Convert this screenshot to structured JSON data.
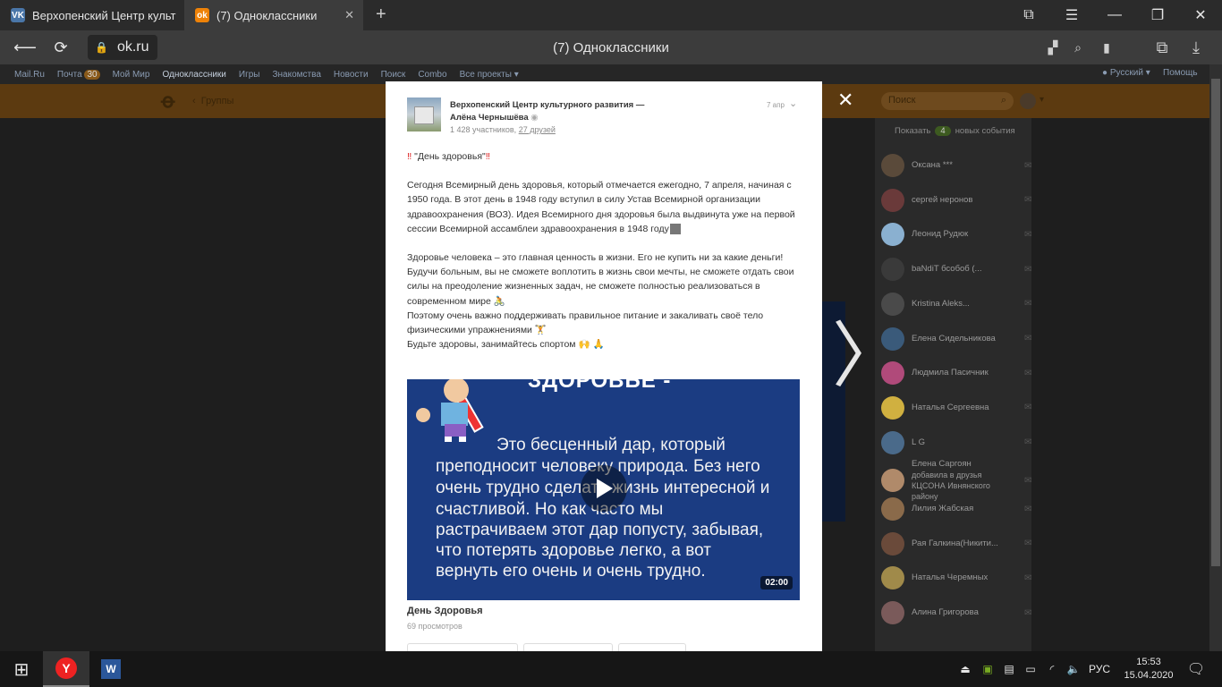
{
  "browser": {
    "tabs": [
      {
        "label": "Верхопенский Центр культ",
        "icon": "vk-icon"
      },
      {
        "label": "(7) Одноклассники",
        "icon": "ok-icon"
      }
    ],
    "url": "ok.ru",
    "page_title": "(7) Одноклассники"
  },
  "portal_bar": {
    "items": [
      "Mail.Ru",
      "Почта",
      "Мой Мир",
      "Одноклассники",
      "Игры",
      "Знакомства",
      "Новости",
      "Поиск",
      "Combo",
      "Все проекты"
    ],
    "mail_count": "30",
    "language": "Русский",
    "help": "Помощь"
  },
  "ok_header": {
    "back_label": "Группы",
    "search_placeholder": "Поиск"
  },
  "feed": {
    "show_label": "Показать",
    "events_count": "4",
    "events_label": "новых события",
    "friends": [
      {
        "name": "Оксана ***"
      },
      {
        "name": "сергей неронов"
      },
      {
        "name": "Леонид Рудюк"
      },
      {
        "name": "baNdiT бсобоб (..."
      },
      {
        "name": "Kristina Aleks..."
      },
      {
        "name": "Елена Сидельникова"
      },
      {
        "name": "Людмила Пасичник"
      },
      {
        "name": "Наталья Сергеевна"
      },
      {
        "name": "L G"
      },
      {
        "name": "Елена Саргоян",
        "note": "добавила в друзья КЦСОНА Ивнянского району"
      },
      {
        "name": "Лилия Жабская"
      },
      {
        "name": "Рая Галкина(Никити..."
      },
      {
        "name": "Наталья Черемных"
      },
      {
        "name": "Алина Григорова"
      }
    ]
  },
  "post": {
    "group_name": "Верхопенский Центр культурного развития —",
    "author": "Алёна Чернышёва",
    "date": "7 апр",
    "members": "1 428 участников,",
    "friends": "27 друзей",
    "title": "\"День здоровья\"",
    "paragraph1": "Сегодня Всемирный день здоровья, который отмечается ежегодно, 7 апреля, начиная с 1950 года. В этот день в 1948 году вступил в силу Устав Всемирной организации здравоохранения (ВОЗ). Идея Всемирного дня здоровья была выдвинута уже на первой сессии Всемирной ассамблеи здравоохранения в 1948 году",
    "paragraph2": "Здоровье человека – это главная ценность в жизни. Его не купить ни за какие деньги! Будучи больным, вы не сможете воплотить в жизнь свои мечты, не сможете отдать свои силы на преодоление жизненных задач, не сможете полностью реализоваться в современном мире",
    "paragraph3": "Поэтому очень важно поддерживать правильное питание и закаливать своё тело физическими упражнениями",
    "paragraph4": "Будьте здоровы, занимайтесь спортом",
    "video": {
      "heading": "ЗДОРОВЬЕ -",
      "lines": [
        "Это бесценный дар, который",
        "преподносит человеку природа. Без него",
        "очень трудно сделать жизнь интересной и",
        "счастливой. Но как часто мы",
        "растрачиваем этот дар попусту, забывая,",
        "что потерять здоровье легко, а вот",
        "вернуть его очень и очень трудно."
      ],
      "duration": "02:00",
      "title": "День Здоровья",
      "views": "69 просмотров"
    }
  },
  "taskbar": {
    "lang": "РУС",
    "time": "15:53",
    "date": "15.04.2020"
  },
  "colors": {
    "ok_orange": "#ee8208",
    "video_blue": "#1b3c82"
  }
}
